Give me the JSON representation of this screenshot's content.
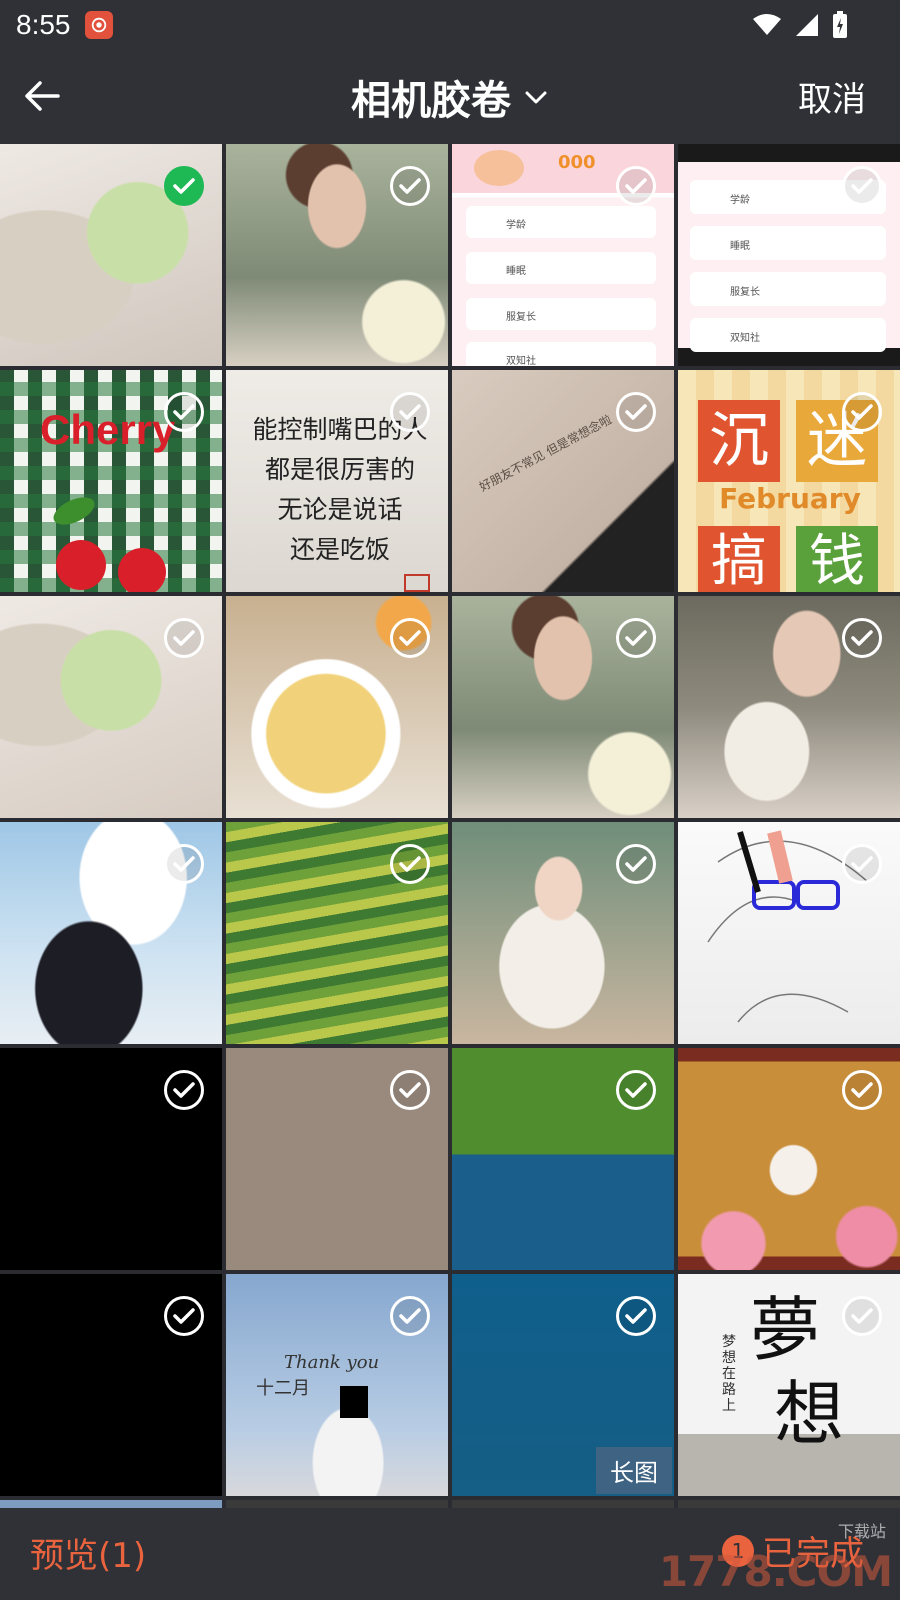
{
  "status_bar": {
    "time": "8:55"
  },
  "toolbar": {
    "title": "相机胶卷",
    "cancel_label": "取消"
  },
  "grid": {
    "tiles": [
      {
        "selected": true
      },
      {
        "selected": false
      },
      {
        "selected": false,
        "text_lines": [
          "000",
          "学龄",
          "睡眠",
          "服复长",
          "双知社"
        ]
      },
      {
        "selected": false,
        "text_lines": [
          "学龄",
          "睡眠",
          "服复长",
          "双知社"
        ]
      },
      {
        "selected": false,
        "text": "Cherry"
      },
      {
        "selected": false,
        "text_lines": [
          "能控制嘴巴的人",
          "都是很厉害的",
          "无论是说话",
          "还是吃饭"
        ]
      },
      {
        "selected": false,
        "text": "好朋友不常见 但是常想念啦"
      },
      {
        "selected": false,
        "text_lines": [
          "沉",
          "迷",
          "February",
          "搞",
          "钱"
        ]
      },
      {
        "selected": false
      },
      {
        "selected": false
      },
      {
        "selected": false
      },
      {
        "selected": false
      },
      {
        "selected": false
      },
      {
        "selected": false
      },
      {
        "selected": false
      },
      {
        "selected": false
      },
      {
        "selected": false
      },
      {
        "selected": false
      },
      {
        "selected": false
      },
      {
        "selected": false
      },
      {
        "selected": false
      },
      {
        "selected": false,
        "text_lines": [
          "Thank you",
          "十二月"
        ]
      },
      {
        "selected": false,
        "badge": "长图"
      },
      {
        "selected": false,
        "text_lines": [
          "夢",
          "想",
          "梦想在路上"
        ]
      }
    ]
  },
  "bottom_bar": {
    "preview_label": "预览(1)",
    "done_count": "1",
    "done_label": "已完成"
  },
  "watermark": {
    "text": "1778.COM",
    "tag": "下载站"
  }
}
